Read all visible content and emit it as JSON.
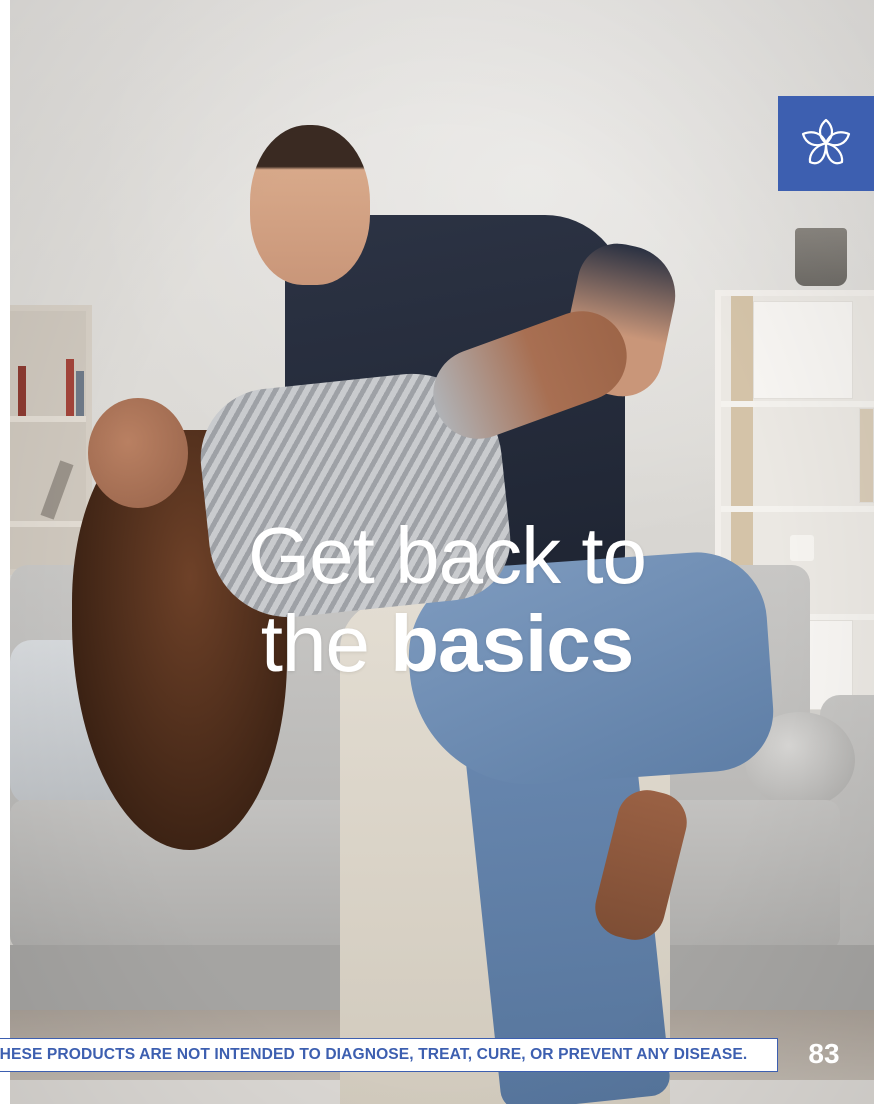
{
  "headline": {
    "line1": "Get back to",
    "line2_regular": "the ",
    "line2_bold": "basics"
  },
  "footer": {
    "disclaimer": "THESE PRODUCTS ARE NOT INTENDED TO DIAGNOSE, TREAT, CURE, OR PREVENT ANY DISEASE.",
    "page_number": "83"
  },
  "logo": {
    "icon": "flower-logo-icon",
    "background_color": "#3d5fb0"
  },
  "colors": {
    "accent": "#3d5fb0",
    "headline_text": "#ffffff"
  },
  "photo": {
    "icon": "photo-couple-dancing"
  }
}
